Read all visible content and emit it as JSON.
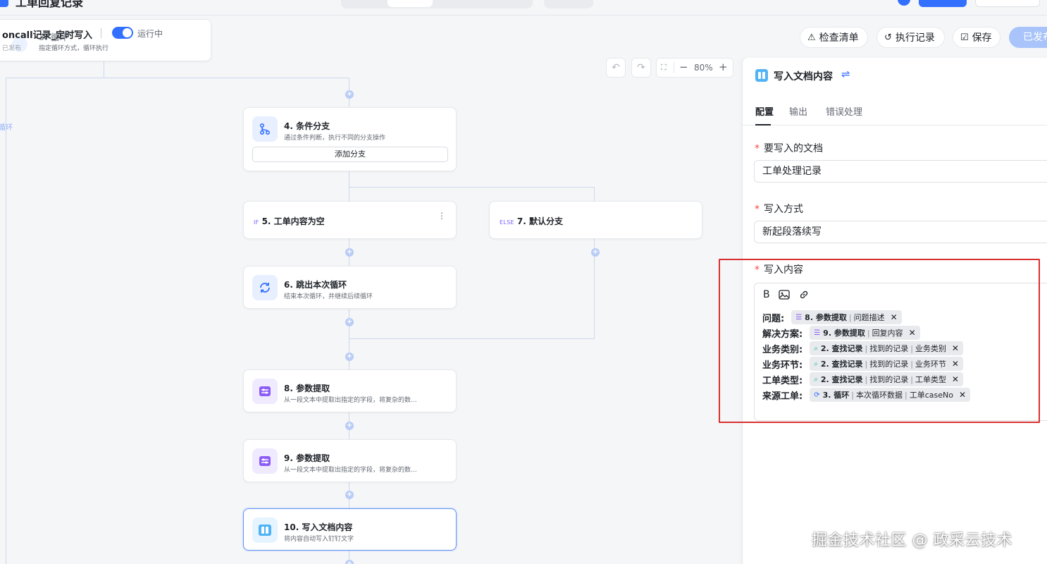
{
  "app": {
    "top_title": "工单回复记录"
  },
  "trigger_node": {
    "title": "oncall记录_定时写入",
    "title_under": "3. 循环",
    "toggle_label": "运行中",
    "status": "已发布",
    "subtitle": "指定循环方式，循环执行"
  },
  "side_label": "循环",
  "actions": {
    "checklist": "检查清单",
    "history": "执行记录",
    "save": "保存",
    "publish": "已发布"
  },
  "canvas_toolbar": {
    "zoom": "80%"
  },
  "nodes": {
    "n4": {
      "title": "4. 条件分支",
      "desc": "通过条件判断，执行不同的分支操作",
      "button": "添加分支"
    },
    "n5": {
      "tag": "IF",
      "title": "5. 工单内容为空"
    },
    "n7": {
      "tag": "ELSE",
      "title": "7. 默认分支"
    },
    "n6": {
      "title": "6. 跳出本次循环",
      "desc": "结束本次循环，并继续后续循环"
    },
    "n8": {
      "title": "8. 参数提取",
      "desc": "从一段文本中提取出指定的字段，将复杂的数..."
    },
    "n9": {
      "title": "9. 参数提取",
      "desc": "从一段文本中提取出指定的字段，将复杂的数..."
    },
    "n10": {
      "title": "10. 写入文档内容",
      "desc": "将内容自动写入钉钉文字"
    }
  },
  "panel": {
    "title": "写入文档内容",
    "tabs": [
      "配置",
      "输出",
      "错误处理"
    ],
    "doc_label": "要写入的文档",
    "doc_value": "工单处理记录",
    "mode_label": "写入方式",
    "mode_value": "新起段落续写",
    "content_label": "写入内容",
    "rows": [
      {
        "key": "问题:",
        "step": "8. 参数提取",
        "rest": [
          "问题描述"
        ],
        "icon": "param"
      },
      {
        "key": "解决方案:",
        "step": "9. 参数提取",
        "rest": [
          "回复内容"
        ],
        "icon": "param"
      },
      {
        "key": "业务类别:",
        "step": "2. 查找记录",
        "rest": [
          "找到的记录",
          "业务类别"
        ],
        "icon": "search"
      },
      {
        "key": "业务环节:",
        "step": "2. 查找记录",
        "rest": [
          "找到的记录",
          "业务环节"
        ],
        "icon": "search"
      },
      {
        "key": "工单类型:",
        "step": "2. 查找记录",
        "rest": [
          "找到的记录",
          "工单类型"
        ],
        "icon": "search"
      },
      {
        "key": "来源工单:",
        "step": "3. 循环",
        "rest": [
          "本次循环数据",
          "工单caseNo"
        ],
        "icon": "loop"
      }
    ]
  },
  "watermark": "掘金技术社区 @ 政采云技术",
  "colors": {
    "accent": "#3370ff",
    "highlight_box": "#d92f2f"
  }
}
